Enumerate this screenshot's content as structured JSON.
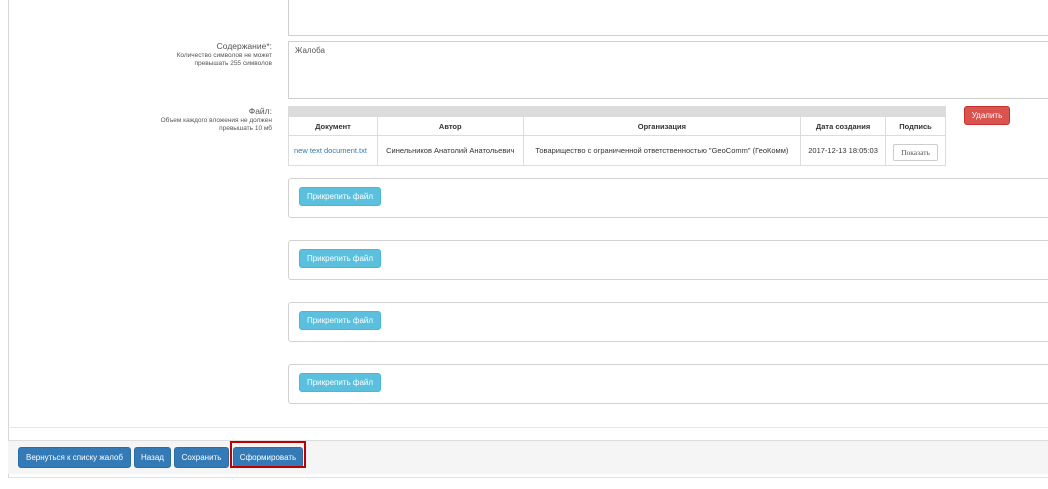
{
  "form": {
    "content_label": "Содержание*:",
    "content_hint": "Количество символов не может превышать 255 символов",
    "content_value": "Жалоба",
    "file_label": "Файл:",
    "file_hint": "Объем каждого вложения не должен превышать 10 мб"
  },
  "files_table": {
    "columns": [
      "Документ",
      "Автор",
      "Организация",
      "Дата создания",
      "Подпись"
    ],
    "rows": [
      {
        "document": "new text document.txt",
        "author": "Синельников Анатолий Анатольевич",
        "organization": "Товарищество с ограниченной ответственностью \"GeoComm\" (ГеоКомм)",
        "created": "2017-12-13 18:05:03",
        "sign_button": "Показать"
      }
    ]
  },
  "delete_label": "Удалить",
  "attach_slots": [
    {
      "label": "Прикрепить файл"
    },
    {
      "label": "Прикрепить файл"
    },
    {
      "label": "Прикрепить файл"
    },
    {
      "label": "Прикрепить файл"
    }
  ],
  "footer": {
    "back_to_list": "Вернуться к списку жалоб",
    "back": "Назад",
    "save": "Сохранить",
    "generate": "Сформировать"
  },
  "colors": {
    "primary": "#337ab7",
    "info": "#5bc0de",
    "danger": "#d9534f",
    "highlight": "#c00000"
  }
}
